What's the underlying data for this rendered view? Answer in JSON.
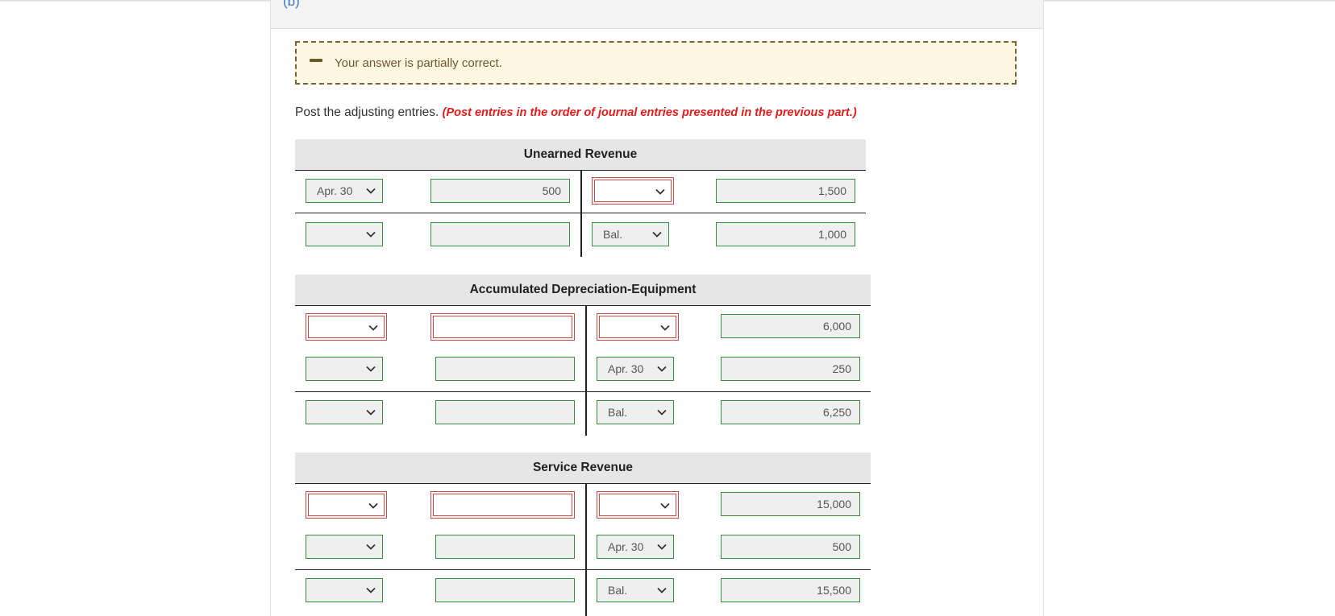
{
  "part_label": "(b)",
  "feedback": {
    "message": "Your answer is partially correct."
  },
  "instruction": {
    "text": "Post the adjusting entries.",
    "note": "(Post entries in the order of journal entries presented in the previous part.)"
  },
  "accounts": [
    {
      "title": "Unearned Revenue",
      "rows": [
        {
          "debit_date": "Apr. 30",
          "debit_amount": "500",
          "credit_date": "",
          "credit_amount": "1,500"
        },
        {
          "debit_date": "",
          "debit_amount": "",
          "credit_date": "Bal.",
          "credit_amount": "1,000"
        }
      ]
    },
    {
      "title": "Accumulated Depreciation-Equipment",
      "rows": [
        {
          "debit_date": "",
          "debit_amount": "",
          "credit_date": "",
          "credit_amount": "6,000"
        },
        {
          "debit_date": "",
          "debit_amount": "",
          "credit_date": "Apr. 30",
          "credit_amount": "250"
        },
        {
          "debit_date": "",
          "debit_amount": "",
          "credit_date": "Bal.",
          "credit_amount": "6,250"
        }
      ]
    },
    {
      "title": "Service Revenue",
      "rows": [
        {
          "debit_date": "",
          "debit_amount": "",
          "credit_date": "",
          "credit_amount": "15,000"
        },
        {
          "debit_date": "",
          "debit_amount": "",
          "credit_date": "Apr. 30",
          "credit_amount": "500"
        },
        {
          "debit_date": "",
          "debit_amount": "",
          "credit_date": "Bal.",
          "credit_amount": "15,500"
        }
      ]
    }
  ],
  "colors": {
    "correct_border": "#3d8b3d",
    "incorrect_border": "#c94a4a",
    "note_red": "#e21b1b",
    "link_blue": "#3a7bbf"
  }
}
